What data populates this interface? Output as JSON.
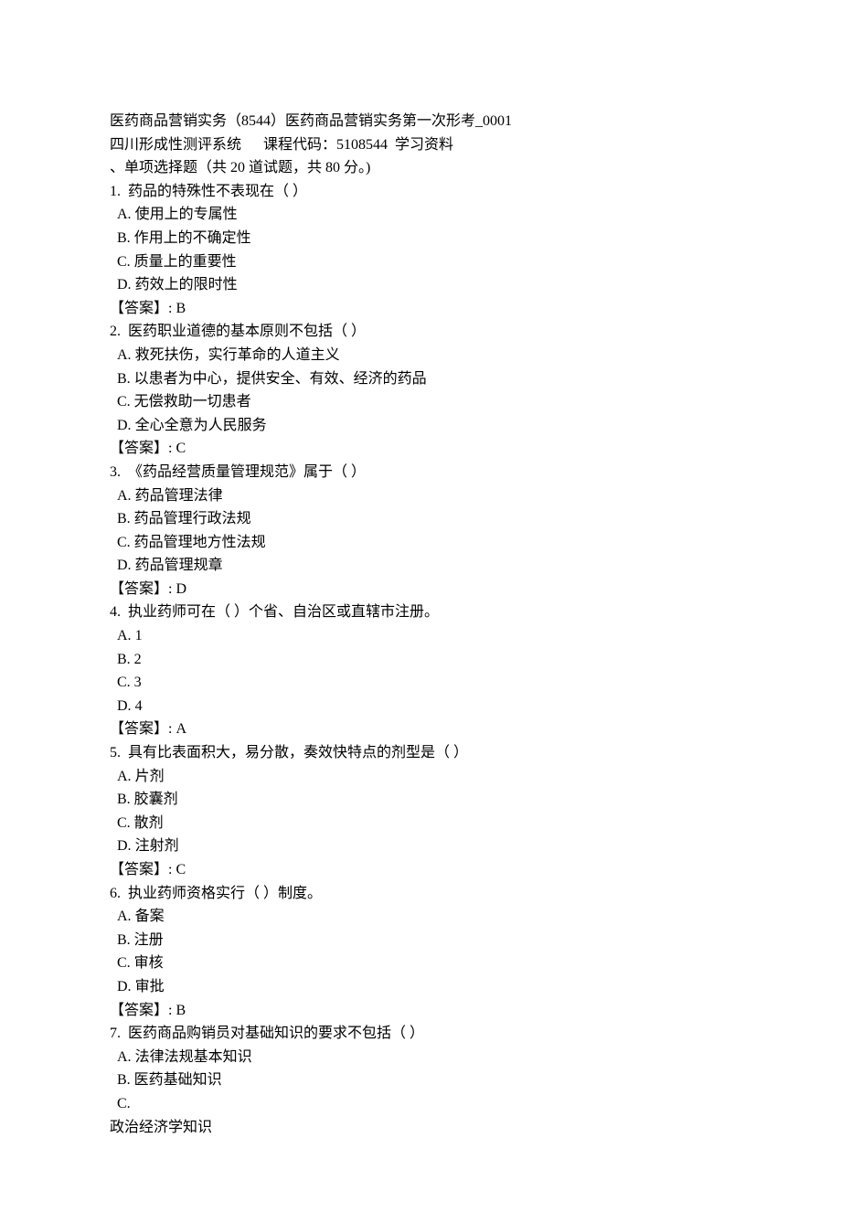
{
  "header": {
    "line1": "医药商品营销实务（8544）医药商品营销实务第一次形考_0001",
    "line2_part1": "四川形成性测评系统",
    "line2_part2": "课程代码：5108544",
    "line2_part3": "学习资料"
  },
  "section_title": "、单项选择题（共 20 道试题，共 80 分。)",
  "questions": [
    {
      "num": "1.",
      "text": "药品的特殊性不表现在（ ）",
      "options": [
        {
          "label": "A.",
          "text": "使用上的专属性"
        },
        {
          "label": "B.",
          "text": "作用上的不确定性"
        },
        {
          "label": "C.",
          "text": "质量上的重要性"
        },
        {
          "label": "D.",
          "text": "药效上的限时性"
        }
      ],
      "answer_label": "【答案】:",
      "answer": "B"
    },
    {
      "num": "2.",
      "text": "医药职业道德的基本原则不包括（ ）",
      "options": [
        {
          "label": "A.",
          "text": "救死扶伤，实行革命的人道主义"
        },
        {
          "label": "B.",
          "text": "以患者为中心，提供安全、有效、经济的药品"
        },
        {
          "label": "C.",
          "text": "无偿救助一切患者"
        },
        {
          "label": "D.",
          "text": "全心全意为人民服务"
        }
      ],
      "answer_label": "【答案】:",
      "answer": "C"
    },
    {
      "num": "3.",
      "text": "《药品经营质量管理规范》属于（ ）",
      "options": [
        {
          "label": "A.",
          "text": "药品管理法律"
        },
        {
          "label": "B.",
          "text": "药品管理行政法规"
        },
        {
          "label": "C.",
          "text": "药品管理地方性法规"
        },
        {
          "label": "D.",
          "text": "药品管理规章"
        }
      ],
      "answer_label": "【答案】:",
      "answer": "D"
    },
    {
      "num": "4.",
      "text": "执业药师可在（ ）个省、自治区或直辖市注册。",
      "options": [
        {
          "label": "A.",
          "text": "1"
        },
        {
          "label": "B.",
          "text": "2"
        },
        {
          "label": "C.",
          "text": "3"
        },
        {
          "label": "D.",
          "text": "4"
        }
      ],
      "answer_label": "【答案】:",
      "answer": "A"
    },
    {
      "num": "5.",
      "text": "具有比表面积大，易分散，奏效快特点的剂型是（ ）",
      "options": [
        {
          "label": "A.",
          "text": "片剂"
        },
        {
          "label": "B.",
          "text": "胶囊剂"
        },
        {
          "label": "C.",
          "text": "散剂"
        },
        {
          "label": "D.",
          "text": "注射剂"
        }
      ],
      "answer_label": "【答案】:",
      "answer": "C"
    },
    {
      "num": "6.",
      "text": "执业药师资格实行（ ）制度。",
      "options": [
        {
          "label": "A.",
          "text": "备案"
        },
        {
          "label": "B.",
          "text": "注册"
        },
        {
          "label": "C.",
          "text": "审核"
        },
        {
          "label": "D.",
          "text": "审批"
        }
      ],
      "answer_label": "【答案】:",
      "answer": "B"
    },
    {
      "num": "7.",
      "text": "医药商品购销员对基础知识的要求不包括（ ）",
      "options": [
        {
          "label": "A.",
          "text": "法律法规基本知识"
        },
        {
          "label": "B.",
          "text": "医药基础知识"
        },
        {
          "label": "C.",
          "text": "",
          "wrapped_text": "政治经济学知识"
        }
      ],
      "answer_label": "",
      "answer": ""
    }
  ]
}
